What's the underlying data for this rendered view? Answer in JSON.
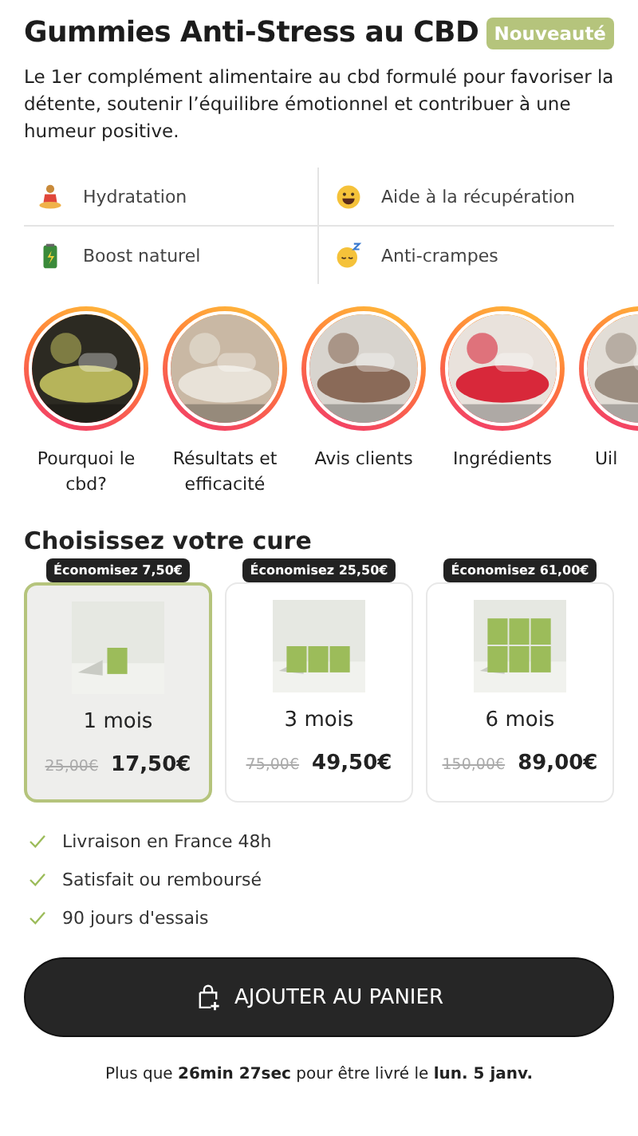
{
  "title": "Gummies Anti-Stress au CBD",
  "badge": "Nouveauté",
  "description": "Le 1er complément alimentaire au cbd formulé pour favoriser la détente, soutenir l’équilibre émotionnel et contribuer à une humeur positive.",
  "features": [
    {
      "label": "Hydratation"
    },
    {
      "label": "Aide à la récupération"
    },
    {
      "label": "Boost naturel"
    },
    {
      "label": "Anti-crampes"
    }
  ],
  "stories": [
    {
      "label": "Pourquoi le cbd?"
    },
    {
      "label": "Résultats et efficacité"
    },
    {
      "label": "Avis clients"
    },
    {
      "label": "Ingrédients"
    },
    {
      "label": "Uil"
    }
  ],
  "offer_heading": "Choisissez votre cure",
  "offers": [
    {
      "saving": "Économisez 7,50€",
      "duration": "1 mois",
      "old_price": "25,00€",
      "price": "17,50€",
      "selected": true
    },
    {
      "saving": "Économisez 25,50€",
      "duration": "3 mois",
      "old_price": "75,00€",
      "price": "49,50€",
      "selected": false
    },
    {
      "saving": "Économisez 61,00€",
      "duration": "6 mois",
      "old_price": "150,00€",
      "price": "89,00€",
      "selected": false
    }
  ],
  "benefits": [
    "Livraison en France 48h",
    "Satisfait ou remboursé",
    "90 jours d'essais"
  ],
  "cart_button": "AJOUTER AU PANIER",
  "delivery_note": "Plus que **26min 27sec** pour être livré le **lun. 5 janv.**"
}
